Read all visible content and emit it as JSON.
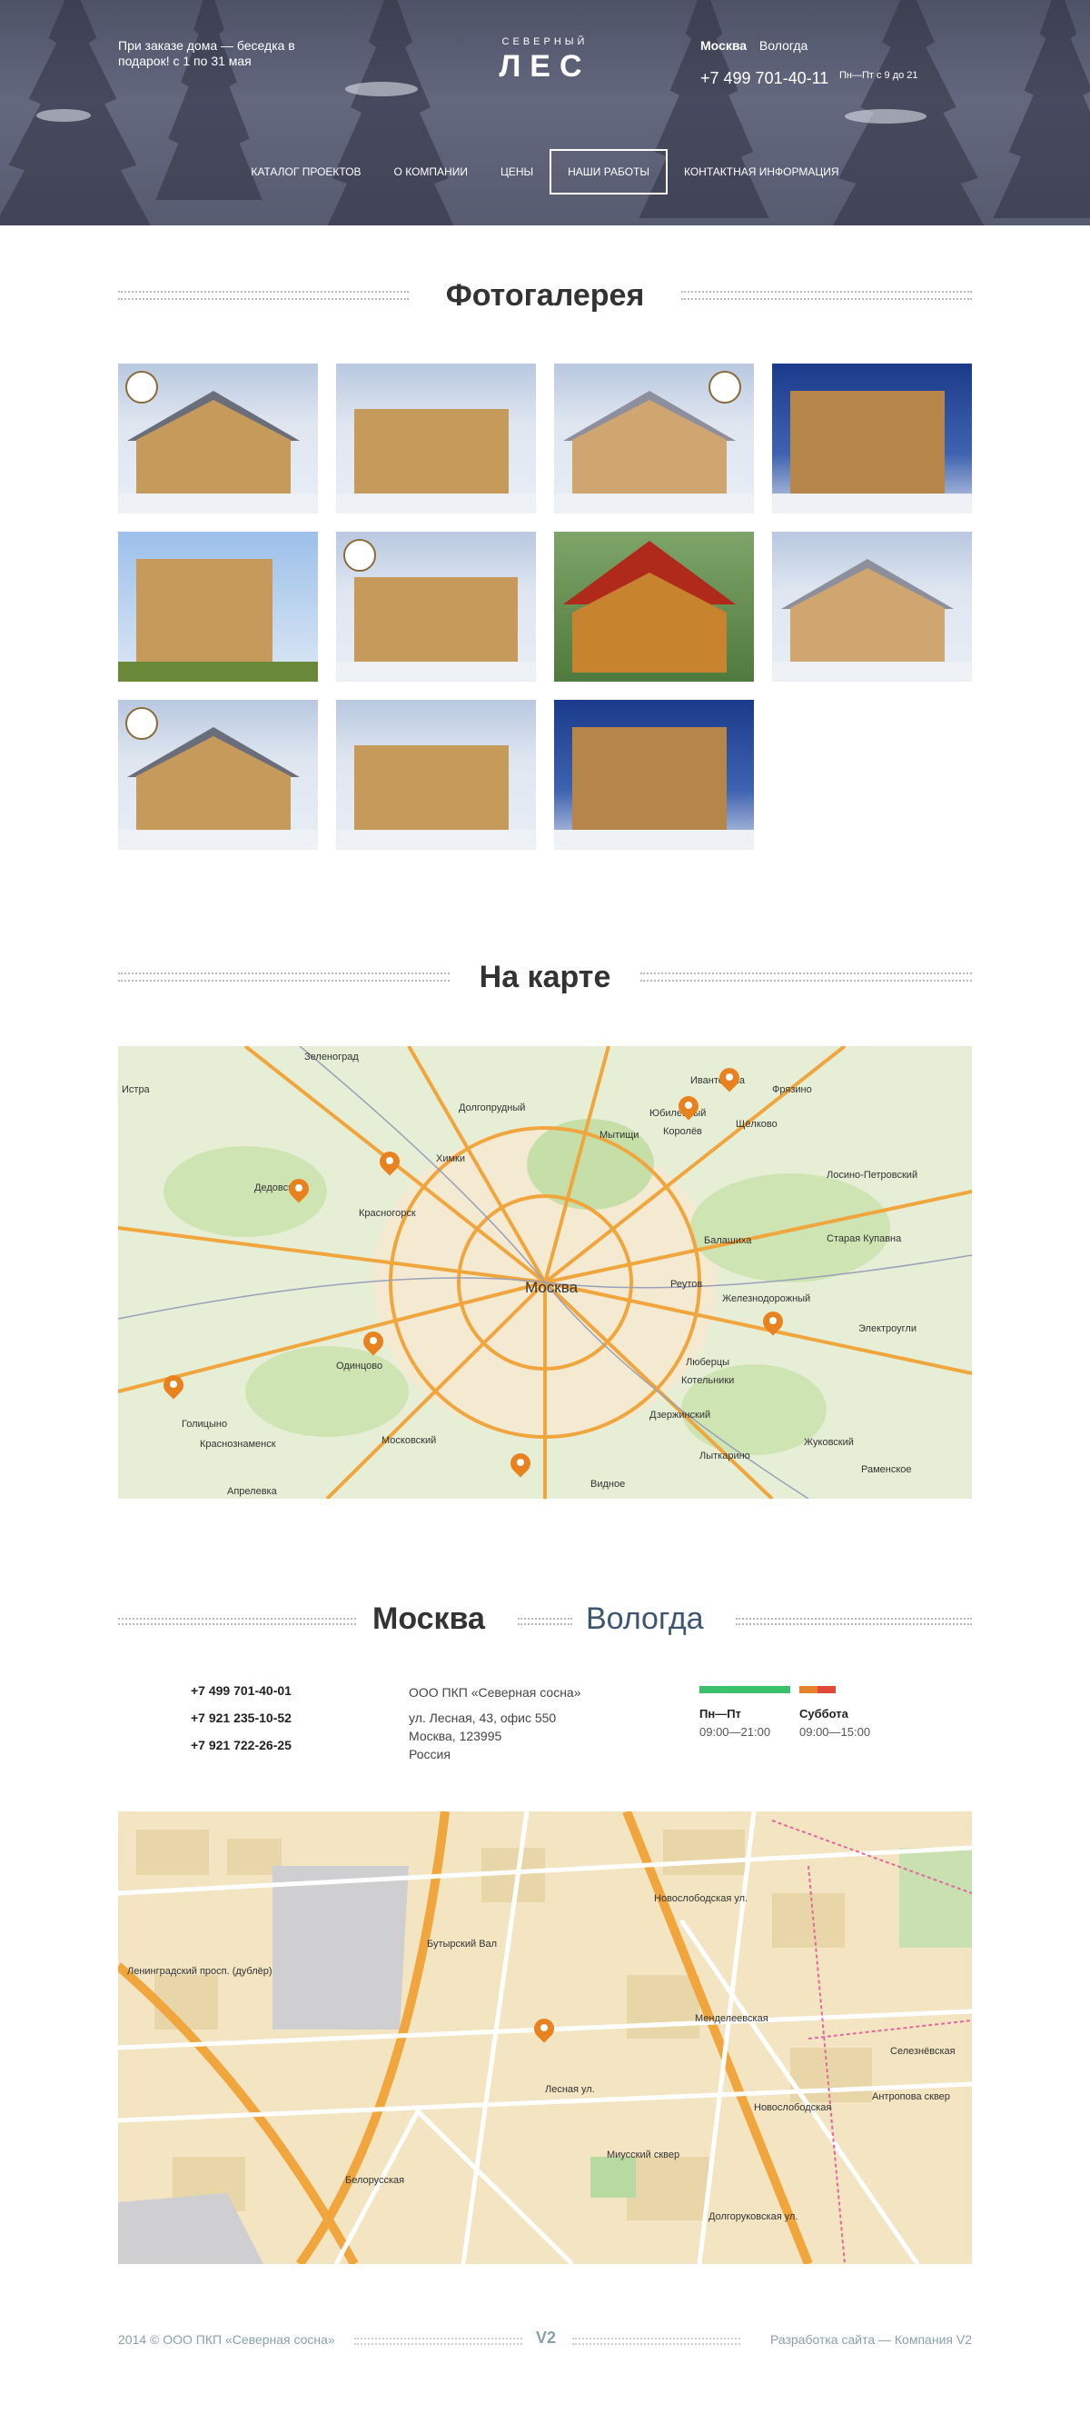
{
  "header": {
    "promo": "При заказе дома — беседка в подарок! с 1 по 31 мая",
    "logo_top": "СЕВЕРНЫЙ",
    "logo_main": "ЛЕС",
    "cities": [
      "Москва",
      "Вологда"
    ],
    "phone": "+7 499 701-40-11",
    "hours": "Пн—Пт с 9 до 21"
  },
  "nav": [
    {
      "label": "КАТАЛОГ ПРОЕКТОВ",
      "active": false
    },
    {
      "label": "О КОМПАНИИ",
      "active": false
    },
    {
      "label": "ЦЕНЫ",
      "active": false
    },
    {
      "label": "НАШИ РАБОТЫ",
      "active": true
    },
    {
      "label": "КОНТАКТНАЯ ИНФОРМАЦИЯ",
      "active": false
    }
  ],
  "gallery": {
    "title": "Фотогалерея",
    "photo_count": 11
  },
  "map_section": {
    "title": "На карте",
    "labels": [
      "Зеленоград",
      "Долгопрудный",
      "Мытищи",
      "Королёв",
      "Юбилейный",
      "Ивантеевка",
      "Щёлково",
      "Фрязино",
      "Химки",
      "Красногорск",
      "Одинцово",
      "Москва",
      "Реутов",
      "Балашиха",
      "Железнодорожный",
      "Люберцы",
      "Котельники",
      "Дзержинский",
      "Лыткарино",
      "Видное",
      "Московский",
      "Краснознаменск",
      "Голицыно",
      "Апрелевка",
      "Истра",
      "Дедовск",
      "Электроугли",
      "Жуковский",
      "Старая Купавна",
      "Лосино-Петровский",
      "Раменское"
    ]
  },
  "contacts": {
    "city_active": "Москва",
    "city_other": "Вологда",
    "phones": [
      "+7 499 701-40-01",
      "+7 921 235-10-52",
      "+7 921 722-26-25"
    ],
    "company": "ООО ПКП «Северная сосна»",
    "address": [
      "ул. Лесная, 43, офис 550",
      "Москва, 123995",
      "Россия"
    ],
    "schedule": [
      {
        "days": "Пн—Пт",
        "time": "09:00—21:00",
        "color": "#3cc06b"
      },
      {
        "days": "Суббота",
        "time": "09:00—15:00",
        "color": "#e8822a"
      }
    ]
  },
  "street_map": {
    "labels": [
      "Белорусская",
      "Менделеевская",
      "Новослободская",
      "Миусский сквер",
      "Долгоруковская ул.",
      "Новослободская ул.",
      "Лесная ул.",
      "Бутырский Вал",
      "Ленинградский просп. (дублёр)",
      "Антропова сквер",
      "Селезнёвская"
    ]
  },
  "footer": {
    "copyright": "2014 © ООО ПКП «Северная сосна»",
    "logo": "V2",
    "credit": "Разработка сайта — Компания V2"
  }
}
